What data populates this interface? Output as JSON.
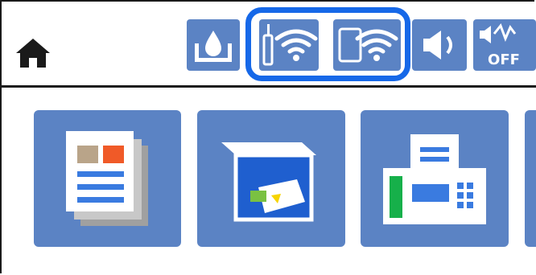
{
  "header": {
    "home_icon": "home-icon",
    "status_icons": [
      {
        "name": "ink-level-icon"
      },
      {
        "name": "wifi-connection-icon"
      },
      {
        "name": "wifi-direct-icon"
      },
      {
        "name": "volume-icon"
      },
      {
        "name": "quiet-mode-off-icon",
        "text": "OFF"
      }
    ],
    "highlight_color": "#1668e8"
  },
  "tiles": [
    {
      "name": "copy-tile",
      "icon": "copy-icon"
    },
    {
      "name": "scan-tile",
      "icon": "scan-icon"
    },
    {
      "name": "fax-tile",
      "icon": "fax-icon"
    }
  ],
  "colors": {
    "tile_bg": "#5b83c4",
    "icon_gray": "#8a8a8a",
    "accent_blue": "#3a7be0",
    "accent_green": "#16b04a",
    "accent_orange": "#f05a28"
  }
}
